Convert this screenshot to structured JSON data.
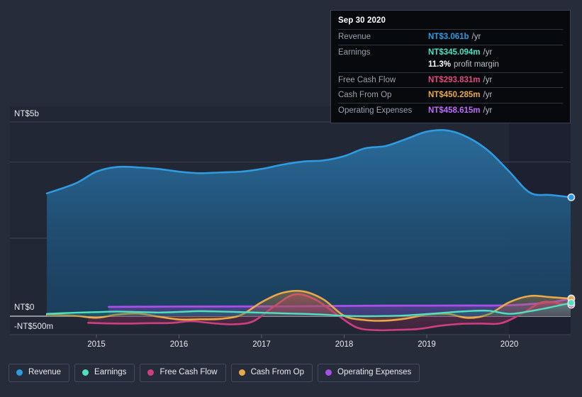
{
  "chart_data": {
    "type": "area",
    "title": "",
    "xlabel": "",
    "ylabel": "",
    "currency": "NT$",
    "grid": true,
    "legend_position": "bottom",
    "y_axis": {
      "ticks": [
        "NT$5b",
        "NT$0",
        "-NT$500m"
      ],
      "tick_values": [
        5000,
        0,
        -500
      ],
      "ylim": [
        -500,
        5500
      ],
      "unit": "NT$ millions"
    },
    "x_axis": {
      "ticks": [
        "2015",
        "2016",
        "2017",
        "2018",
        "2019",
        "2020"
      ],
      "tick_values": [
        2015,
        2016,
        2017,
        2018,
        2019,
        2020
      ],
      "xlim": [
        2014.4,
        2021.0
      ]
    },
    "series": [
      {
        "name": "Revenue",
        "color": "#2e9be0",
        "x": [
          2014.4,
          2014.75,
          2015.0,
          2015.25,
          2015.5,
          2015.75,
          2016.0,
          2016.25,
          2016.5,
          2016.75,
          2017.0,
          2017.25,
          2017.5,
          2017.75,
          2018.0,
          2018.25,
          2018.5,
          2018.75,
          2019.0,
          2019.25,
          2019.5,
          2019.75,
          2020.0,
          2020.25,
          2020.5,
          2020.75
        ],
        "values": [
          3160,
          3420,
          3720,
          3840,
          3830,
          3790,
          3720,
          3680,
          3700,
          3720,
          3790,
          3900,
          3980,
          4010,
          4120,
          4320,
          4380,
          4560,
          4750,
          4780,
          4600,
          4250,
          3720,
          3180,
          3120,
          3061
        ]
      },
      {
        "name": "Earnings",
        "color": "#4fe0c0",
        "x": [
          2014.4,
          2014.75,
          2015.0,
          2015.25,
          2015.5,
          2015.75,
          2016.0,
          2016.25,
          2016.5,
          2016.75,
          2017.0,
          2017.25,
          2017.5,
          2017.75,
          2018.0,
          2018.25,
          2018.5,
          2018.75,
          2019.0,
          2019.25,
          2019.5,
          2019.75,
          2020.0,
          2020.25,
          2020.5,
          2020.75
        ],
        "values": [
          60,
          90,
          105,
          120,
          108,
          95,
          110,
          130,
          120,
          105,
          90,
          75,
          60,
          40,
          10,
          0,
          5,
          20,
          55,
          95,
          130,
          140,
          60,
          130,
          230,
          345
        ]
      },
      {
        "name": "Free Cash Flow",
        "color": "#cf3f80",
        "x": [
          2014.9,
          2015.15,
          2015.4,
          2015.65,
          2015.9,
          2016.15,
          2016.4,
          2016.65,
          2016.9,
          2017.15,
          2017.4,
          2017.65,
          2017.9,
          2018.15,
          2018.4,
          2018.65,
          2018.9,
          2019.15,
          2019.4,
          2019.65,
          2019.9,
          2020.15,
          2020.4,
          2020.65,
          2020.75
        ],
        "values": [
          -170,
          -185,
          -190,
          -180,
          -175,
          -130,
          -180,
          -210,
          -130,
          250,
          560,
          430,
          60,
          -290,
          -360,
          -350,
          -330,
          -250,
          -200,
          -190,
          -180,
          60,
          360,
          310,
          294
        ]
      },
      {
        "name": "Cash From Op",
        "color": "#e8a94a",
        "x": [
          2014.4,
          2014.75,
          2015.0,
          2015.25,
          2015.5,
          2015.75,
          2016.0,
          2016.25,
          2016.5,
          2016.75,
          2017.0,
          2017.25,
          2017.5,
          2017.75,
          2018.0,
          2018.25,
          2018.5,
          2018.75,
          2019.0,
          2019.25,
          2019.5,
          2019.75,
          2020.0,
          2020.25,
          2020.5,
          2020.75
        ],
        "values": [
          35,
          10,
          -40,
          40,
          70,
          -10,
          -85,
          -80,
          -70,
          30,
          360,
          600,
          640,
          430,
          10,
          -100,
          -115,
          -60,
          40,
          60,
          -45,
          50,
          360,
          520,
          490,
          450
        ]
      },
      {
        "name": "Operating Expenses",
        "color": "#a74fe8",
        "x": [
          2015.15,
          2015.5,
          2016.0,
          2016.5,
          2017.0,
          2017.5,
          2018.0,
          2018.5,
          2019.0,
          2019.5,
          2020.0,
          2020.5,
          2020.75
        ],
        "values": [
          240,
          243,
          248,
          250,
          252,
          256,
          265,
          270,
          272,
          275,
          280,
          360,
          459
        ]
      }
    ],
    "forecast_boundary_x": 2020.0,
    "last_point_marker": true
  },
  "tooltip": {
    "date": "Sep 30 2020",
    "rows": [
      {
        "label": "Revenue",
        "value": "NT$3.061b",
        "unit": "/yr",
        "color": "#2e9be0",
        "rule": true
      },
      {
        "label": "Earnings",
        "value": "NT$345.094m",
        "unit": "/yr",
        "color": "#4fe0c0",
        "rule": true
      },
      {
        "label": "",
        "value": "11.3%",
        "unit": "profit margin",
        "color": "#ffffff",
        "rule": false
      },
      {
        "label": "Free Cash Flow",
        "value": "NT$293.831m",
        "unit": "/yr",
        "color": "#e5497f",
        "rule": true
      },
      {
        "label": "Cash From Op",
        "value": "NT$450.285m",
        "unit": "/yr",
        "color": "#e8a94a",
        "rule": true
      },
      {
        "label": "Operating Expenses",
        "value": "NT$458.615m",
        "unit": "/yr",
        "color": "#c06bff",
        "rule": true
      }
    ]
  },
  "legend": {
    "items": [
      {
        "label": "Revenue",
        "color": "#2e9be0"
      },
      {
        "label": "Earnings",
        "color": "#4fe0c0"
      },
      {
        "label": "Free Cash Flow",
        "color": "#cf3f80"
      },
      {
        "label": "Cash From Op",
        "color": "#e8a94a"
      },
      {
        "label": "Operating Expenses",
        "color": "#a74fe8"
      }
    ]
  },
  "y_axis_labels": {
    "top": "NT$5b",
    "zero": "NT$0",
    "negative": "-NT$500m"
  },
  "colors": {
    "background": "#272c3a",
    "plot_background": "#222735",
    "forecast_background": "#1b2030",
    "gridline": "#3b4050",
    "zero_line": "#c9ccd4"
  }
}
